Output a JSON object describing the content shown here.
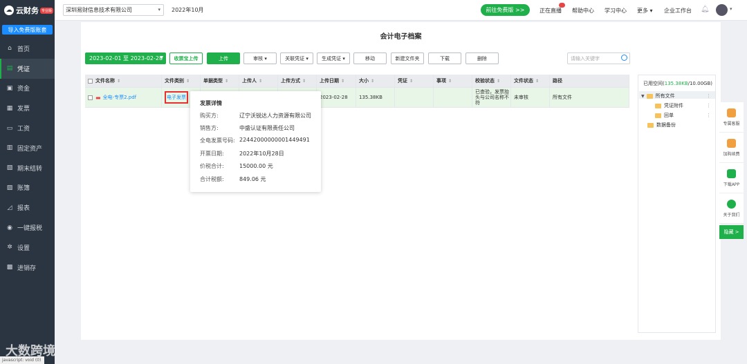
{
  "app": {
    "logo_text": "云财务",
    "logo_badge": "专业版",
    "import_button": "导入免费版账套"
  },
  "sidebar": {
    "items": [
      {
        "label": "首页",
        "icon": "home-icon",
        "glyph": "⌂"
      },
      {
        "label": "凭证",
        "icon": "voucher-icon",
        "glyph": "▤",
        "active": true
      },
      {
        "label": "资金",
        "icon": "fund-icon",
        "glyph": "▣"
      },
      {
        "label": "发票",
        "icon": "invoice-icon",
        "glyph": "▦"
      },
      {
        "label": "工资",
        "icon": "salary-icon",
        "glyph": "▭"
      },
      {
        "label": "固定资产",
        "icon": "asset-icon",
        "glyph": "▥"
      },
      {
        "label": "期末结转",
        "icon": "period-close-icon",
        "glyph": "▧"
      },
      {
        "label": "账簿",
        "icon": "ledger-icon",
        "glyph": "▨"
      },
      {
        "label": "报表",
        "icon": "report-icon",
        "glyph": "◿"
      },
      {
        "label": "一键报税",
        "icon": "tax-icon",
        "glyph": "◉"
      },
      {
        "label": "设置",
        "icon": "settings-icon",
        "glyph": "✲"
      },
      {
        "label": "进销存",
        "icon": "inventory-icon",
        "glyph": "▩"
      }
    ]
  },
  "header": {
    "company": "深圳易财信息技术有限公司",
    "period": "2022年10月",
    "free_button": "前往免费版 >>",
    "links": [
      "正在直播",
      "帮助中心",
      "学习中心",
      "更多 ▾",
      "企业工作台"
    ]
  },
  "page": {
    "title": "会计电子档案"
  },
  "toolbar": {
    "date_range": "2023-02-01 至 2023-02-28",
    "buttons": [
      {
        "label": "收票宝上传",
        "style": "outline-green"
      },
      {
        "label": "上传",
        "style": "green"
      },
      {
        "label": "审核 ▾",
        "style": "plain"
      },
      {
        "label": "关联凭证 ▾",
        "style": "plain"
      },
      {
        "label": "生成凭证 ▾",
        "style": "plain"
      },
      {
        "label": "移动",
        "style": "plain"
      },
      {
        "label": "新建文件夹",
        "style": "plain"
      },
      {
        "label": "下载",
        "style": "plain"
      },
      {
        "label": "删除",
        "style": "plain"
      }
    ],
    "search_placeholder": "请输入关键字"
  },
  "table": {
    "columns": [
      "文件名称",
      "文件类别",
      "单据类型",
      "上传人",
      "上传方式",
      "上传日期",
      "大小",
      "凭证",
      "事项",
      "校验状态",
      "文件状态",
      "路径"
    ],
    "rows": [
      {
        "file_name": "全电-专票2.pdf",
        "file_type": "电子发票",
        "doc_type": "",
        "uploader": "",
        "upload_method": "",
        "upload_date": "2023-02-28",
        "size": "135.38KB",
        "voucher": "",
        "item": "",
        "check_status": "已查验，发票抬头与公司名称不符",
        "file_status": "未审核",
        "path": "所有文件"
      }
    ]
  },
  "popover": {
    "title": "发票详情",
    "fields": [
      {
        "label": "购买方:",
        "value": "辽宁沃锐达人力资源有限公司"
      },
      {
        "label": "销售方:",
        "value": "中盛认证有限责任公司"
      },
      {
        "label": "全电发票号码:",
        "value": "22442000000001449491"
      },
      {
        "label": "开票日期:",
        "value": "2022年10月28日"
      },
      {
        "label": "价税合计:",
        "value": "15000.00 元"
      },
      {
        "label": "合计税额:",
        "value": "849.06 元"
      }
    ]
  },
  "storage": {
    "prefix": "已用空间(",
    "used": "135.38KB",
    "total": "/10.00GB)",
    "tree": [
      {
        "label": "所有文件",
        "level": 0
      },
      {
        "label": "凭证附件",
        "level": 1
      },
      {
        "label": "回单",
        "level": 1
      },
      {
        "label": "数据备份",
        "level": 0
      }
    ]
  },
  "float_bar": {
    "items": [
      {
        "label": "专属客服",
        "icon": "headset-icon",
        "color": "#f0a040"
      },
      {
        "label": "加购续费",
        "icon": "cart-icon",
        "color": "#f0a040"
      },
      {
        "label": "下载APP",
        "icon": "phone-icon",
        "color": "#20b04b"
      },
      {
        "label": "关于我们",
        "icon": "wechat-icon",
        "color": "#20b04b"
      }
    ],
    "hide_label": "隐藏 >"
  },
  "watermark": "大数跨境",
  "statusbar": "javascript: void (0)"
}
